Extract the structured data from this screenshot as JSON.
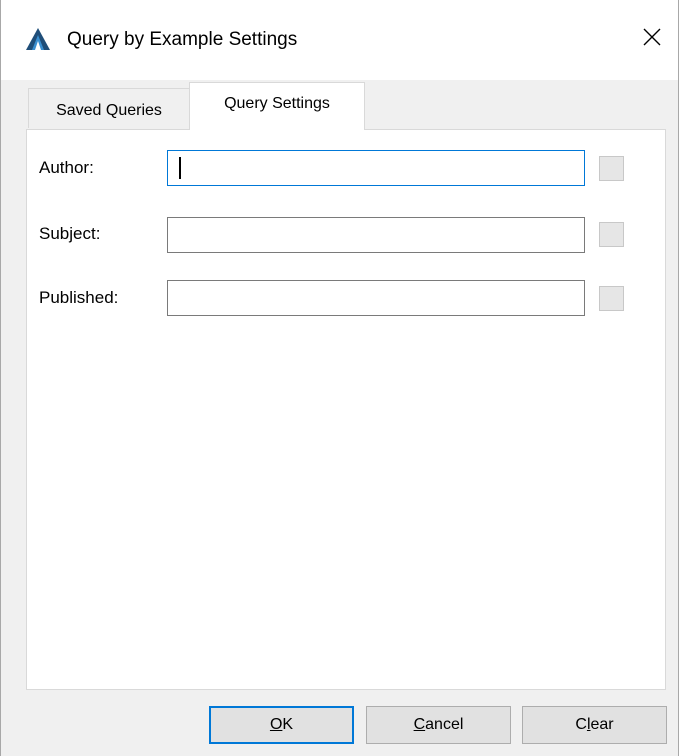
{
  "window": {
    "title": "Query by Example Settings",
    "app_icon": "triangle-logo-icon",
    "close_icon": "close-icon"
  },
  "tabs": [
    {
      "label": "Saved Queries",
      "active": false
    },
    {
      "label": "Query Settings",
      "active": true
    }
  ],
  "fields": [
    {
      "label": "Author:",
      "value": "",
      "focused": true,
      "checked": false
    },
    {
      "label": "Subject:",
      "value": "",
      "focused": false,
      "checked": false
    },
    {
      "label": "Published:",
      "value": "",
      "focused": false,
      "checked": false
    }
  ],
  "buttons": {
    "ok": {
      "label": "OK",
      "accel": "O",
      "rest": "K"
    },
    "cancel": {
      "label": "Cancel",
      "accel": "C",
      "rest": "ancel"
    },
    "clear": {
      "label": "Clear",
      "pre": "C",
      "accel": "l",
      "rest": "ear"
    }
  },
  "colors": {
    "focus_accent": "#0078d7",
    "logo_blue": "#1f4e79"
  }
}
